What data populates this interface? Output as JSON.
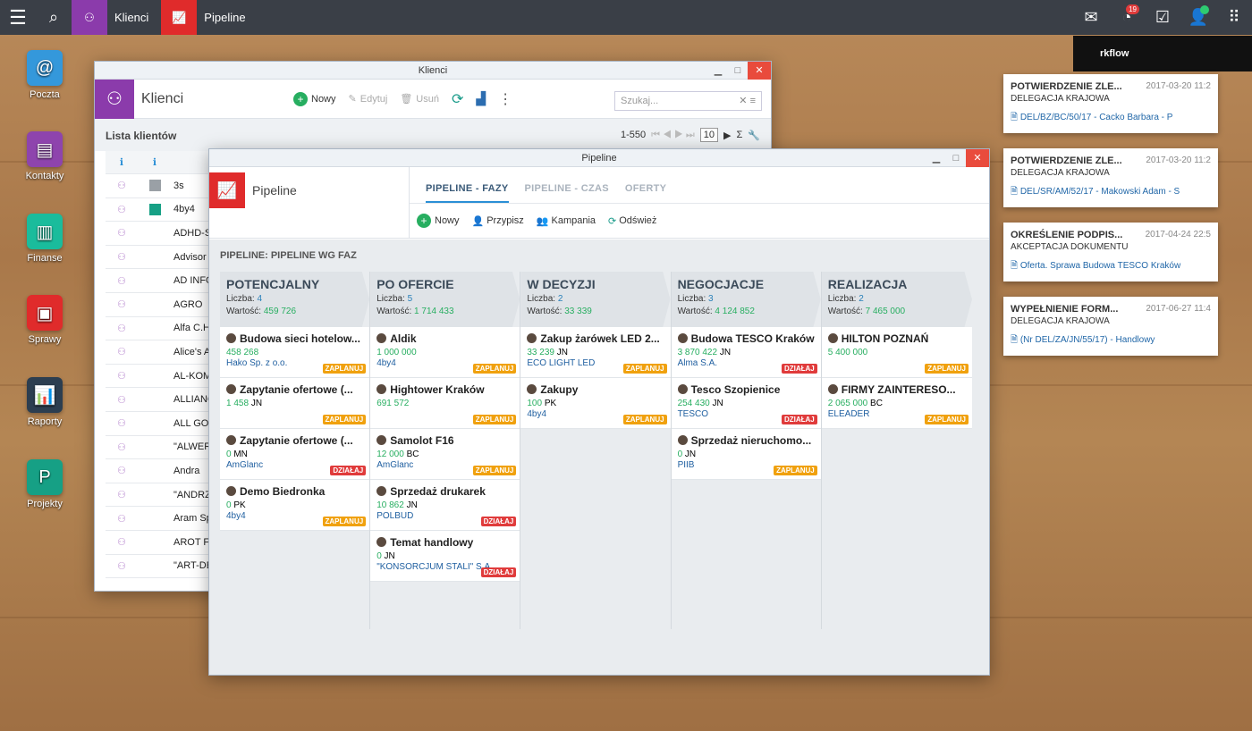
{
  "topbar": {
    "apps": [
      {
        "label": "Klienci",
        "color": "#8b3bab"
      },
      {
        "label": "Pipeline",
        "color": "#e02b2b"
      }
    ],
    "notification_count": "19"
  },
  "desktop": [
    {
      "label": "Poczta",
      "color": "#3498db"
    },
    {
      "label": "Kontakty",
      "color": "#8e44ad"
    },
    {
      "label": "Finanse",
      "color": "#1abc9c"
    },
    {
      "label": "Sprawy",
      "color": "#e02b2b"
    },
    {
      "label": "Raporty",
      "color": "#2c3e50"
    },
    {
      "label": "Projekty",
      "color": "#16a085"
    }
  ],
  "workflow": {
    "title": "rkflow",
    "items": [
      {
        "title": "POTWIERDZENIE ZLE...",
        "date": "2017-03-20 11:2",
        "sub": "DELEGACJA KRAJOWA",
        "link": "DEL/BZ/BC/50/17 - Cacko Barbara - P"
      },
      {
        "title": "POTWIERDZENIE ZLE...",
        "date": "2017-03-20 11:2",
        "sub": "DELEGACJA KRAJOWA",
        "link": "DEL/SR/AM/52/17 - Makowski Adam - S"
      },
      {
        "title": "OKREŚLENIE PODPIS...",
        "date": "2017-04-24 22:5",
        "sub": "AKCEPTACJA DOKUMENTU",
        "link": "Oferta. Sprawa Budowa TESCO Kraków"
      },
      {
        "title": "WYPEŁNIENIE FORM...",
        "date": "2017-06-27 11:4",
        "sub": "DELEGACJA KRAJOWA",
        "link": "(Nr DEL/ZA/JN/55/17) - Handlowy"
      }
    ]
  },
  "klienci": {
    "window_title": "Klienci",
    "title": "Klienci",
    "new": "Nowy",
    "edit": "Edytuj",
    "delete": "Usuń",
    "search_placeholder": "Szukaj...",
    "list_title": "Lista klientów",
    "range": "1-550",
    "page_size": "10",
    "rows": [
      {
        "name": "3s",
        "color": "#9aa0a6"
      },
      {
        "name": "4by4",
        "color": "#16a085"
      },
      {
        "name": "ADHD-S"
      },
      {
        "name": "Advisor"
      },
      {
        "name": "AD INFO"
      },
      {
        "name": "AGRO"
      },
      {
        "name": "Alfa C.H"
      },
      {
        "name": "Alice's A"
      },
      {
        "name": "AL-KOM"
      },
      {
        "name": "ALLIANC"
      },
      {
        "name": "ALL GO"
      },
      {
        "name": "\"ALWER"
      },
      {
        "name": "Andra"
      },
      {
        "name": "\"ANDRZ"
      },
      {
        "name": "Aram Sp"
      },
      {
        "name": "AROT F"
      },
      {
        "name": "\"ART-DE"
      }
    ]
  },
  "pipeline": {
    "window_title": "Pipeline",
    "title": "Pipeline",
    "tabs": [
      "PIPELINE - FAZY",
      "PIPELINE - CZAS",
      "OFERTY"
    ],
    "tools": [
      "Nowy",
      "Przypisz",
      "Kampania",
      "Odśwież"
    ],
    "subtitle": "PIPELINE: PIPELINE WG FAZ",
    "count_label": "Liczba:",
    "value_label": "Wartość:",
    "columns": [
      {
        "name": "POTENCJALNY",
        "count": "4",
        "value": "459 726",
        "cards": [
          {
            "title": "Budowa sieci hotelow...",
            "amount": "458 268",
            "unit": "",
            "company": "Hako Sp. z o.o.",
            "tag": "ZAPLANUJ",
            "kind": "z"
          },
          {
            "title": "Zapytanie ofertowe (...",
            "amount": "1 458",
            "unit": "JN",
            "company": "",
            "tag": "ZAPLANUJ",
            "kind": "z"
          },
          {
            "title": "Zapytanie ofertowe (...",
            "amount": "0",
            "unit": "MN",
            "company": "AmGlanc",
            "tag": "DZIAŁAJ",
            "kind": "d"
          },
          {
            "title": "Demo Biedronka",
            "amount": "0",
            "unit": "PK",
            "company": "4by4",
            "tag": "ZAPLANUJ",
            "kind": "z"
          }
        ]
      },
      {
        "name": "PO OFERCIE",
        "count": "5",
        "value": "1 714 433",
        "cards": [
          {
            "title": "Aldik",
            "amount": "1 000 000",
            "unit": "",
            "company": "4by4",
            "tag": "ZAPLANUJ",
            "kind": "z"
          },
          {
            "title": "Hightower Kraków",
            "amount": "691 572",
            "unit": "",
            "company": "",
            "tag": "ZAPLANUJ",
            "kind": "z"
          },
          {
            "title": "Samolot F16",
            "amount": "12 000",
            "unit": "BC",
            "company": "AmGlanc",
            "tag": "ZAPLANUJ",
            "kind": "z"
          },
          {
            "title": "Sprzedaż drukarek",
            "amount": "10 862",
            "unit": "JN",
            "company": "POLBUD",
            "tag": "DZIAŁAJ",
            "kind": "d"
          },
          {
            "title": "Temat handlowy",
            "amount": "0",
            "unit": "JN",
            "company": "\"KONSORCJUM STALI\" S.A.",
            "tag": "DZIAŁAJ",
            "kind": "d"
          }
        ]
      },
      {
        "name": "W DECYZJI",
        "count": "2",
        "value": "33 339",
        "cards": [
          {
            "title": "Zakup żarówek LED 2...",
            "amount": "33 239",
            "unit": "JN",
            "company": "ECO LIGHT LED",
            "tag": "ZAPLANUJ",
            "kind": "z"
          },
          {
            "title": "Zakupy",
            "amount": "100",
            "unit": "PK",
            "company": "4by4",
            "tag": "ZAPLANUJ",
            "kind": "z"
          }
        ]
      },
      {
        "name": "NEGOCJACJE",
        "count": "3",
        "value": "4 124 852",
        "cards": [
          {
            "title": "Budowa TESCO Kraków",
            "amount": "3 870 422",
            "unit": "JN",
            "company": "Alma S.A.",
            "tag": "DZIAŁAJ",
            "kind": "d"
          },
          {
            "title": "Tesco Szopienice",
            "amount": "254 430",
            "unit": "JN",
            "company": "TESCO",
            "tag": "DZIAŁAJ",
            "kind": "d"
          },
          {
            "title": "Sprzedaż nieruchomo...",
            "amount": "0",
            "unit": "JN",
            "company": "PIIB",
            "tag": "ZAPLANUJ",
            "kind": "z"
          }
        ]
      },
      {
        "name": "REALIZACJA",
        "count": "2",
        "value": "7 465 000",
        "cards": [
          {
            "title": "HILTON POZNAŃ",
            "amount": "5 400 000",
            "unit": "",
            "company": "",
            "tag": "ZAPLANUJ",
            "kind": "z"
          },
          {
            "title": "FIRMY ZAINTERESO...",
            "amount": "2 065 000",
            "unit": "BC",
            "company": "ELEADER",
            "tag": "ZAPLANUJ",
            "kind": "z"
          }
        ]
      }
    ]
  }
}
